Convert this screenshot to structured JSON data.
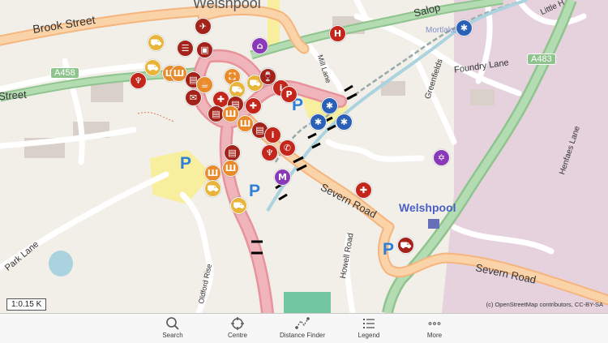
{
  "map": {
    "labels": {
      "welshpool_town": "Welshpool",
      "brook_street": "Brook Street",
      "a458": "A458",
      "street_left": "Street",
      "salop": "Salop",
      "a483": "A483",
      "foundry_lane": "Foundry Lane",
      "greenfields": "Greenfields",
      "little_h": "Little H",
      "mill_lane": "Mill Lane",
      "severn_road_1": "Severn Road",
      "severn_road_2": "Severn Road",
      "herfaes_lane": "Henfaes Lane",
      "howell_road": "Howell Road",
      "park_lane": "Park Lane",
      "oldford_rise": "Oldford Rise",
      "welshpool_station": "Welshpool",
      "mortlake": "Mortlake"
    },
    "parking_symbol": "P",
    "scale": "1:0.15 K",
    "attribution": "(c) OpenStreetMap contributors, CC-BY-SA"
  },
  "toolbar": {
    "search": "Search",
    "centre": "Centre",
    "distance": "Distance Finder",
    "legend": "Legend",
    "more": "More"
  },
  "colors": {
    "background": "#f2efe9",
    "main_road": "#e8929c",
    "secondary_road": "#fbd3a8",
    "trunk_road": "#9fd39e",
    "water": "#aad3df",
    "parking_area": "#f7ee9e",
    "poi_red": "#c4261b",
    "poi_orange": "#e98a2b",
    "poi_yellow": "#e8b43a",
    "poi_purple": "#8a3ab9",
    "poi_blue": "#2a61b7",
    "toolbar_bg": "#f7f7f7"
  }
}
